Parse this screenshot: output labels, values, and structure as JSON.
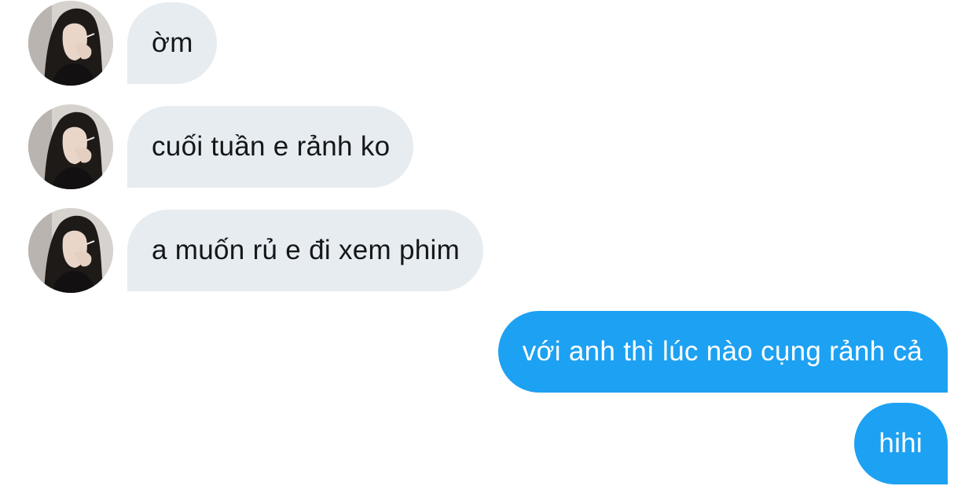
{
  "conversation": {
    "messages": [
      {
        "direction": "incoming",
        "text": "ờm",
        "avatar_icon": "user-avatar-icon"
      },
      {
        "direction": "incoming",
        "text": "cuối tuần e rảnh ko",
        "avatar_icon": "user-avatar-icon"
      },
      {
        "direction": "incoming",
        "text": "a muốn rủ e đi xem phim",
        "avatar_icon": "user-avatar-icon"
      },
      {
        "direction": "outgoing",
        "text": "với anh thì lúc nào cụng rảnh cả"
      },
      {
        "direction": "outgoing",
        "text": "hihi"
      }
    ]
  },
  "colors": {
    "incoming_bubble": "#e6ecf0",
    "incoming_text": "#14171a",
    "outgoing_bubble": "#1da1f2",
    "outgoing_text": "#ffffff",
    "background": "#ffffff"
  }
}
